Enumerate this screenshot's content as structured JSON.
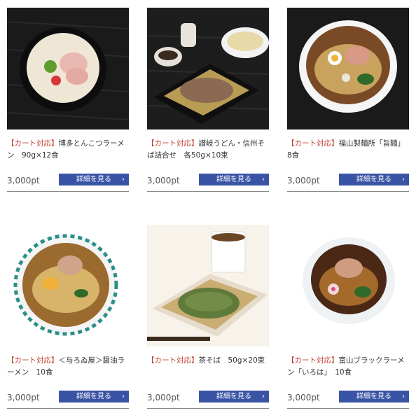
{
  "products": [
    {
      "cart_tag": "【カート対応】",
      "name": "博多とんこつラーメン　90g×12食",
      "price": "3,000pt",
      "button_label": "詳細を見る",
      "image_icon": "ramen-tonkotsu-image"
    },
    {
      "cart_tag": "【カート対応】",
      "name": "讃岐うどん・信州そば詰合せ　各50g×10束",
      "price": "3,000pt",
      "button_label": "詳細を見る",
      "image_icon": "udon-soba-image"
    },
    {
      "cart_tag": "【カート対応】",
      "name": "福山製麺所「旨麺」　8食",
      "price": "3,000pt",
      "button_label": "詳細を見る",
      "image_icon": "ramen-shoyu-image"
    },
    {
      "cart_tag": "【カート対応】",
      "name": "＜与ろゐ屋＞醤油ラーメン　10食",
      "price": "3,000pt",
      "button_label": "詳細を見る",
      "image_icon": "ramen-yoroiya-image"
    },
    {
      "cart_tag": "【カート対応】",
      "name": "茶そば　50g×20束",
      "price": "3,000pt",
      "button_label": "詳細を見る",
      "image_icon": "cha-soba-image"
    },
    {
      "cart_tag": "【カート対応】",
      "name": "富山ブラックラーメン「いろは」　10食",
      "price": "3,000pt",
      "button_label": "詳細を見る",
      "image_icon": "toyama-black-ramen-image"
    }
  ],
  "colors": {
    "cart_tag": "#c0392b",
    "button_bg": "#3a54a5",
    "button_text": "#ffffff"
  }
}
